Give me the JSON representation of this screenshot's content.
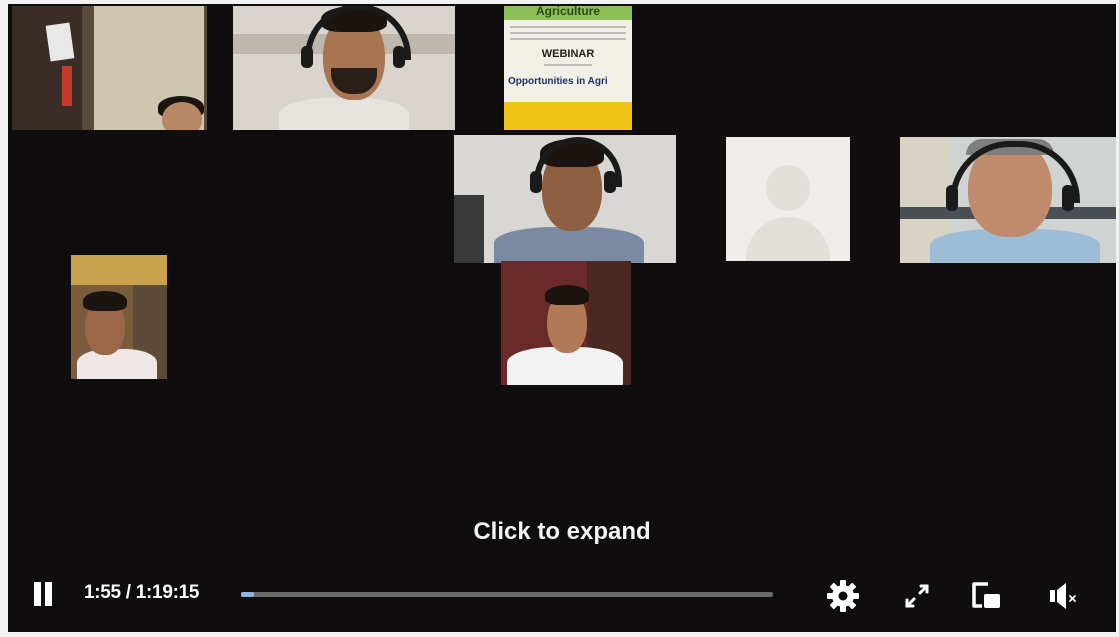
{
  "player": {
    "caption": "Click to expand",
    "time": {
      "current": "1:55",
      "separator": " / ",
      "total": "1:19:15"
    },
    "progress_fraction": 0.025
  },
  "poster": {
    "heading": "Agriculture",
    "title": "WEBINAR",
    "subtitle": "Opportunities in Agri"
  },
  "colors": {
    "background": "#0f0d0e",
    "progress_fill": "#8fb4e6",
    "progress_track": "#6a6a6a",
    "text": "#ffffff"
  },
  "icons": {
    "pause": "pause-icon",
    "settings": "gear-icon",
    "expand": "expand-icon",
    "pip": "picture-in-picture-icon",
    "mute": "muted-speaker-icon"
  }
}
